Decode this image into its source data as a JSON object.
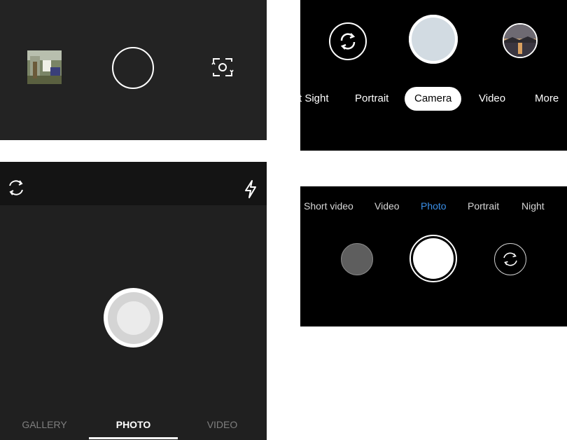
{
  "panel_a": {
    "gallery_thumbnail": "gallery-thumbnail",
    "shutter": "shutter-button",
    "switch_camera_icon": "switch-camera-icon"
  },
  "panel_b": {
    "flip_icon": "refresh-flip-icon",
    "shutter": "shutter-button",
    "thumbnail": "sunset-thumbnail",
    "modes": [
      "t Sight",
      "Portrait",
      "Camera",
      "Video",
      "More"
    ],
    "active_mode": "Camera"
  },
  "panel_c": {
    "flip_icon": "flip-camera-icon",
    "flash_icon": "flash-icon",
    "tabs": [
      "GALLERY",
      "PHOTO",
      "VIDEO"
    ],
    "active_tab": "PHOTO"
  },
  "panel_d": {
    "modes": [
      "Short video",
      "Video",
      "Photo",
      "Portrait",
      "Night"
    ],
    "active_mode": "Photo",
    "colors": {
      "active": "#3a8fe8"
    }
  }
}
